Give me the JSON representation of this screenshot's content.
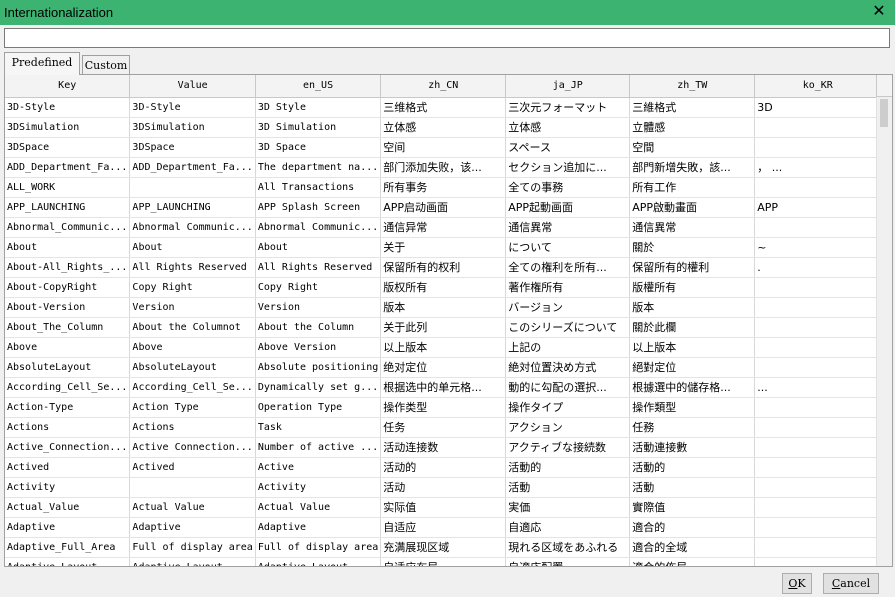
{
  "window": {
    "title": "Internationalization",
    "close_glyph": "✕"
  },
  "search": {
    "value": "",
    "placeholder": ""
  },
  "tabs": [
    {
      "label": "Predefined",
      "active": true
    },
    {
      "label": "Custom",
      "active": false
    }
  ],
  "table": {
    "columns": [
      "Key",
      "Value",
      "en_US",
      "zh_CN",
      "ja_JP",
      "zh_TW",
      "ko_KR"
    ],
    "rows": [
      [
        "3D-Style",
        "3D-Style",
        "3D Style",
        "三维格式",
        "三次元フォーマット",
        "三維格式",
        "3D"
      ],
      [
        "3DSimulation",
        "3DSimulation",
        "3D Simulation",
        "立体感",
        "立体感",
        "立體感",
        ""
      ],
      [
        "3DSpace",
        "3DSpace",
        "3D Space",
        "空间",
        "スペース",
        "空間",
        ""
      ],
      [
        "ADD_Department_Fa...",
        "ADD_Department_Fa...",
        "The department na...",
        "部门添加失败，该...",
        "セクション追加に...",
        "部門新增失敗，該...",
        "，  ..."
      ],
      [
        "ALL_WORK",
        "",
        "All Transactions",
        "所有事务",
        "全ての事務",
        "所有工作",
        ""
      ],
      [
        "APP_LAUNCHING",
        "APP_LAUNCHING",
        "APP Splash Screen",
        "APP启动画面",
        "APP起動画面",
        "APP啟動畫面",
        "APP"
      ],
      [
        "Abnormal_Communic...",
        "Abnormal Communic...",
        "Abnormal Communic...",
        "通信异常",
        "通信異常",
        "通信異常",
        ""
      ],
      [
        "About",
        "About",
        "About",
        "关于",
        "について",
        "關於",
        "~"
      ],
      [
        "About-All_Rights_...",
        "All Rights Reserved",
        "All Rights Reserved",
        "保留所有的权利",
        "全ての権利を所有...",
        "保留所有的權利",
        "."
      ],
      [
        "About-CopyRight",
        "Copy Right",
        "Copy Right",
        "版权所有",
        "著作権所有",
        "版權所有",
        ""
      ],
      [
        "About-Version",
        "Version",
        "Version",
        "版本",
        "バージョン",
        "版本",
        ""
      ],
      [
        "About_The_Column",
        "About the Columnot",
        "About the Column",
        "关于此列",
        "このシリーズについて",
        "關於此欄",
        ""
      ],
      [
        "Above",
        "Above",
        "Above Version",
        "以上版本",
        "上記の",
        "以上版本",
        ""
      ],
      [
        "AbsoluteLayout",
        "AbsoluteLayout",
        "Absolute positioning",
        "绝对定位",
        "絶対位置決め方式",
        "絕對定位",
        ""
      ],
      [
        "According_Cell_Se...",
        "According_Cell_Se...",
        "Dynamically set g...",
        "根据选中的单元格...",
        "動的に勾配の選択...",
        "根據選中的儲存格...",
        "..."
      ],
      [
        "Action-Type",
        "Action Type",
        "Operation Type",
        "操作类型",
        "操作タイプ",
        "操作類型",
        ""
      ],
      [
        "Actions",
        "Actions",
        "Task",
        "任务",
        "アクション",
        "任務",
        ""
      ],
      [
        "Active_Connection...",
        "Active Connection...",
        "Number of active ...",
        "活动连接数",
        "アクティブな接続数",
        "活動連接數",
        ""
      ],
      [
        "Actived",
        "Actived",
        "Active",
        "活动的",
        "活動的",
        "活動的",
        ""
      ],
      [
        "Activity",
        "",
        "Activity",
        "活动",
        "活動",
        "活動",
        ""
      ],
      [
        "Actual_Value",
        "Actual Value",
        "Actual Value",
        "实际值",
        "実価",
        "實際值",
        ""
      ],
      [
        "Adaptive",
        "Adaptive",
        "Adaptive",
        "自适应",
        "自適応",
        "適合的",
        ""
      ],
      [
        "Adaptive_Full_Area",
        "Full of display area",
        "Full of display area",
        "充满展现区域",
        "現れる区域をあふれる",
        "適合的全域",
        ""
      ],
      [
        "Adaptive_Layout",
        "Adaptive_Layout",
        "Adaptive_Layout",
        "自适应布局",
        "自適応配置",
        "適合的佈局",
        ""
      ]
    ]
  },
  "buttons": {
    "ok": {
      "mnemonic": "O",
      "rest": "K"
    },
    "cancel": {
      "mnemonic": "C",
      "rest": "ancel"
    }
  },
  "colors": {
    "titlebar": "#3cb371"
  }
}
